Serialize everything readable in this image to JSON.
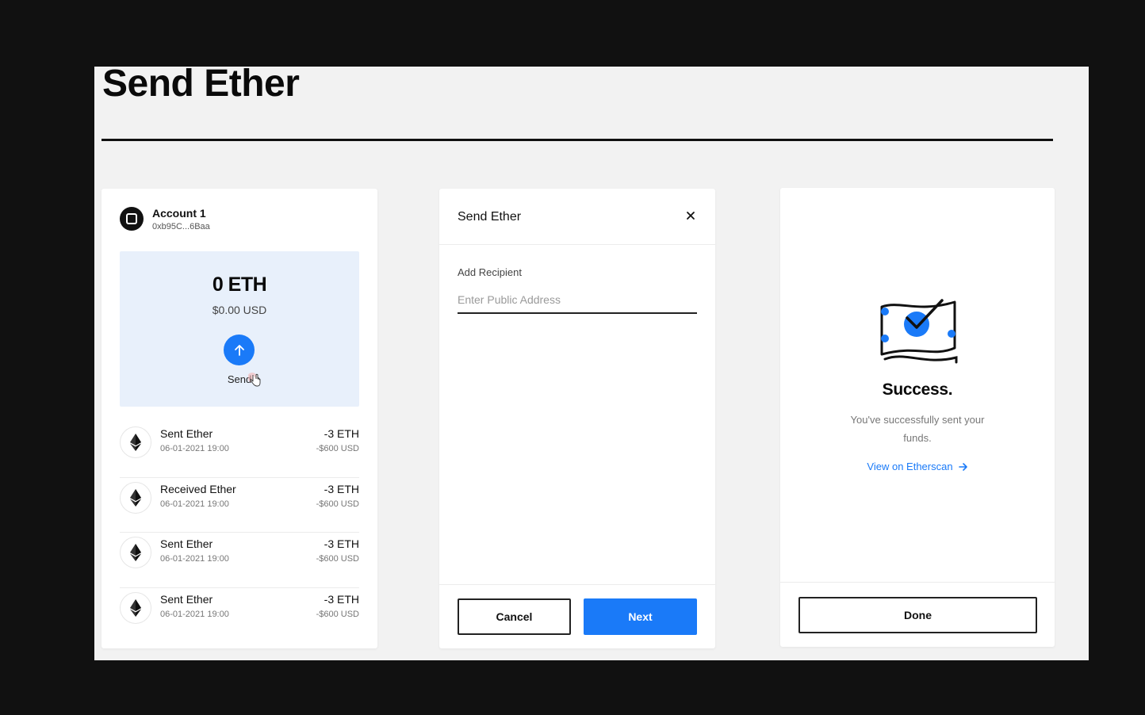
{
  "page": {
    "title": "Send Ether"
  },
  "account": {
    "name": "Account 1",
    "address": "0xb95C...6Baa",
    "balance_eth": "0 ETH",
    "balance_usd": "$0.00 USD",
    "send_label": "Send"
  },
  "transactions": [
    {
      "title": "Sent Ether",
      "date": "06-01-2021 19:00",
      "amount": "-3 ETH",
      "usd": "-$600 USD",
      "icon": "ethereum-icon"
    },
    {
      "title": "Received Ether",
      "date": "06-01-2021 19:00",
      "amount": "-3 ETH",
      "usd": "-$600 USD",
      "icon": "ethereum-icon"
    },
    {
      "title": "Sent Ether",
      "date": "06-01-2021 19:00",
      "amount": "-3 ETH",
      "usd": "-$600 USD",
      "icon": "ethereum-icon"
    },
    {
      "title": "Sent Ether",
      "date": "06-01-2021 19:00",
      "amount": "-3 ETH",
      "usd": "-$600 USD",
      "icon": "ethereum-icon"
    }
  ],
  "send_dialog": {
    "title": "Send Ether",
    "recipient_label": "Add Recipient",
    "recipient_placeholder": "Enter Public Address",
    "recipient_value": "",
    "cancel_label": "Cancel",
    "next_label": "Next"
  },
  "success": {
    "title": "Success.",
    "message": "You've successfully sent your funds.",
    "link_label": "View on Etherscan",
    "done_label": "Done"
  },
  "colors": {
    "accent": "#1a7af8",
    "balance_bg": "#e8f0fb",
    "canvas_bg": "#f2f2f2",
    "frame_bg": "#111111"
  }
}
